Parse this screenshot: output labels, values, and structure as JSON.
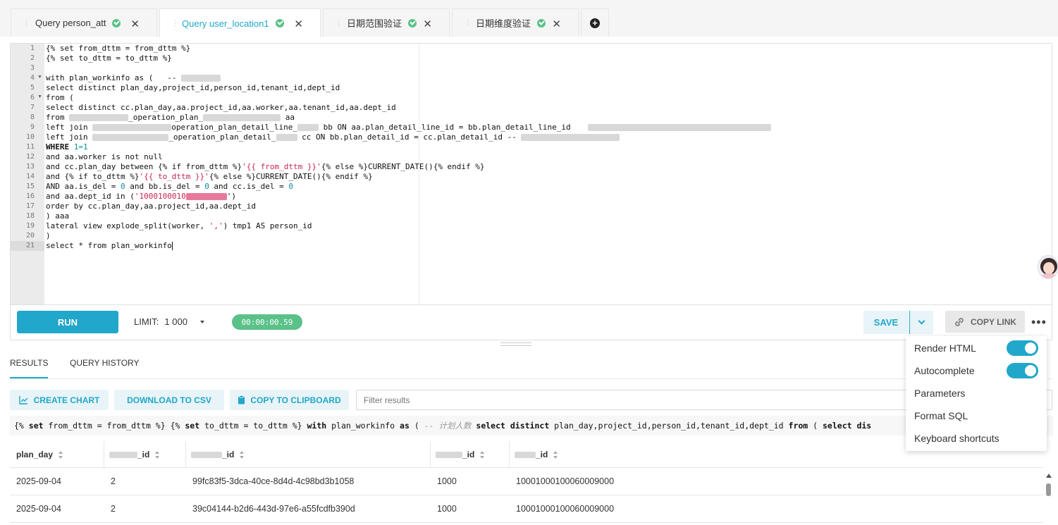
{
  "tabs": [
    {
      "label": "Query person_att",
      "active": false
    },
    {
      "label": "Query user_location1",
      "active": true
    },
    {
      "label": "日期范围验证",
      "active": false
    },
    {
      "label": "日期维度验证",
      "active": false
    }
  ],
  "tab_close_glyph": "✕",
  "add_tab_glyph": "+",
  "editor": {
    "line_numbers": [
      "1",
      "2",
      "3",
      "4",
      "5",
      "6",
      "7",
      "8",
      "9",
      "10",
      "11",
      "12",
      "13",
      "14",
      "15",
      "16",
      "17",
      "18",
      "19",
      "20",
      "21"
    ],
    "lines": {
      "l1": "{% set from_dttm = from_dttm %}",
      "l2": "{% set to_dttm = to_dttm %}",
      "l4": "with plan_workinfo as (   --",
      "l5": "select distinct plan_day,project_id,person_id,tenant_id,dept_id",
      "l6": "from (",
      "l7": "select distinct cc.plan_day,aa.project_id,aa.worker,aa.tenant_id,aa.dept_id",
      "l8a": "from ",
      "l8b": "_operation_plan_",
      "l8c": " aa",
      "l9a": "left join ",
      "l9b": "operation_plan_detail_line_",
      "l9c": " bb ON aa.plan_detail_line_id = bb.plan_detail_line_id",
      "l10a": "left join ",
      "l10b": "_operation_plan_detail_",
      "l10c": " cc ON bb.plan_detail_id = cc.plan_detail_id --",
      "l11a": "WHERE ",
      "l11b": "1=1",
      "l12": "and aa.worker is not null",
      "l13a": "and cc.plan_day between {% if from_dttm %}",
      "l13b": "'{{ from_dttm }}'",
      "l13c": "{% else %}CURRENT_DATE(){% endif %}",
      "l14a": "and {% if to_dttm %}",
      "l14b": "'{{ to_dttm }}'",
      "l14c": "{% else %}CURRENT_DATE(){% endif %}",
      "l15a": "AND aa.is_del = ",
      "l15b": "0",
      "l15c": " and bb.is_del = ",
      "l15d": "0",
      "l15e": " and cc.is_del = ",
      "l15f": "0",
      "l16a": "and aa.dept_id in (",
      "l16b": "'1000100010",
      "l16c": "')",
      "l17": "order by cc.plan_day,aa.project_id,aa.dept_id",
      "l18": ") aaa",
      "l19a": "lateral view explode_split(worker, ",
      "l19b": "','",
      "l19c": ") tmp1 AS person_id",
      "l20": ")",
      "l21": "select * from plan_workinfo"
    }
  },
  "toolbar": {
    "run_label": "RUN",
    "limit_label": "LIMIT:",
    "limit_value": "1 000",
    "timer": "00:00:00.59",
    "save_label": "SAVE",
    "copy_link_label": "COPY LINK",
    "more_glyph": "•••"
  },
  "results": {
    "tab_results": "RESULTS",
    "tab_history": "QUERY HISTORY",
    "create_chart": "CREATE CHART",
    "download_csv": "DOWNLOAD TO CSV",
    "copy_clipboard": "COPY TO CLIPBOARD",
    "filter_placeholder": "Filter results",
    "sql_preview": {
      "p1": "{% ",
      "p2": "set",
      "p3": " from_dttm = from_dttm %} {% ",
      "p4": "set",
      "p5": " to_dttm = to_dttm %} ",
      "p6": "with",
      "p7": " plan_workinfo ",
      "p8": "as",
      "p9": " ( ",
      "p10": "-- 计划人数",
      "p11": " ",
      "p12": "select distinct",
      "p13": " plan_day,project_id,person_id,tenant_id,dept_id ",
      "p14": "from",
      "p15": " ( ",
      "p16": "select dis"
    },
    "columns": [
      "plan_day",
      "_id",
      "_id",
      "_id",
      "_id"
    ],
    "rows": [
      [
        "2025-09-04",
        "2",
        "99fc83f5-3dca-40ce-8d4d-4c98bd3b1058",
        "1000",
        "10001000100060009000"
      ],
      [
        "2025-09-04",
        "2",
        "39c04144-b2d6-443d-97e6-a55fcdfb390d",
        "1000",
        "10001000100060009000"
      ]
    ]
  },
  "menu": {
    "render_html": "Render HTML",
    "autocomplete": "Autocomplete",
    "parameters": "Parameters",
    "format_sql": "Format SQL",
    "keyboard_shortcuts": "Keyboard shortcuts",
    "render_html_on": true,
    "autocomplete_on": true
  },
  "colors": {
    "accent": "#20a7c9",
    "success": "#5ac189",
    "string": "#c7254e"
  }
}
